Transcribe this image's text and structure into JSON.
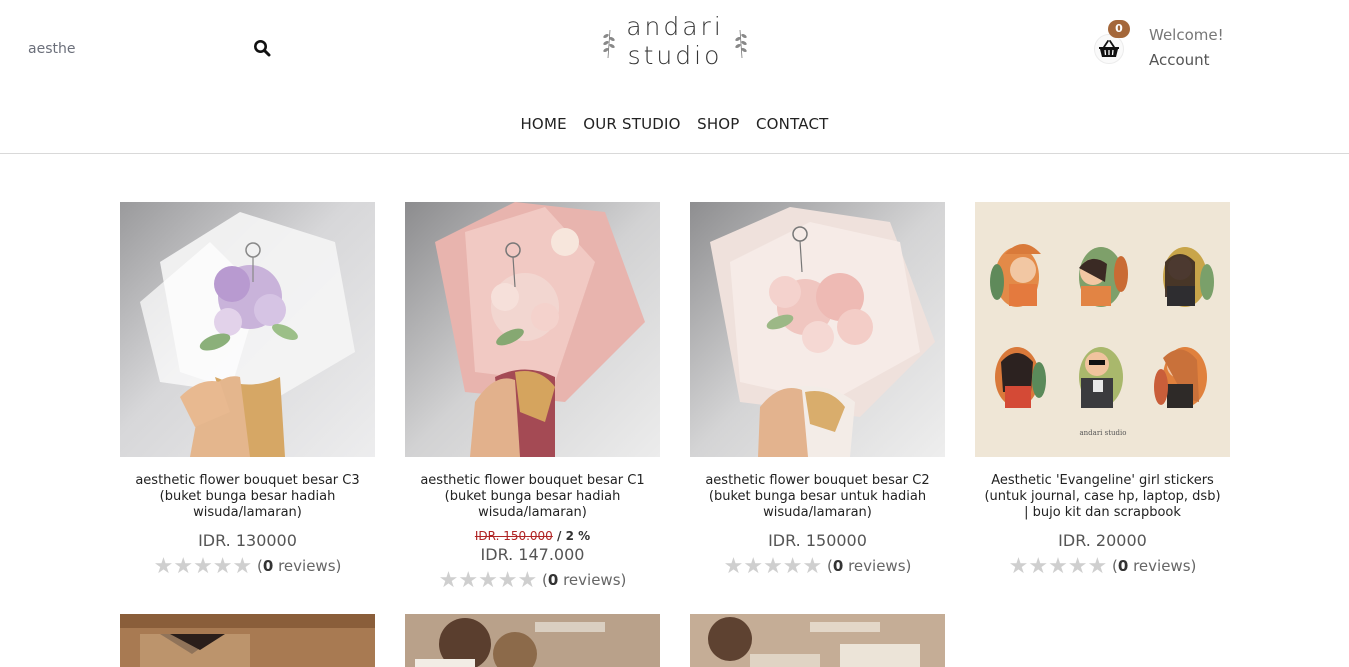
{
  "search": {
    "value": "aesthe",
    "placeholder": ""
  },
  "logo": {
    "line1": "andari",
    "line2": "studio"
  },
  "cart": {
    "count": "0"
  },
  "account": {
    "welcome": "Welcome!",
    "label": "Account"
  },
  "nav": [
    "HOME",
    "OUR STUDIO",
    "SHOP",
    "CONTACT"
  ],
  "products": [
    {
      "title": "aesthetic flower bouquet besar C3 (buket bunga besar hadiah wisuda/lamaran)",
      "price": "IDR. 130000",
      "old_price": "",
      "discount": "",
      "stars": "★★★★★",
      "reviews_prefix": "(",
      "reviews_count": "0",
      "reviews_suffix": " reviews)"
    },
    {
      "title": "aesthetic flower bouquet besar C1 (buket bunga besar hadiah wisuda/lamaran)",
      "price": "IDR. 147.000",
      "old_price": "IDR. 150.000",
      "discount": " / 2 %",
      "stars": "★★★★★",
      "reviews_prefix": "(",
      "reviews_count": "0",
      "reviews_suffix": " reviews)"
    },
    {
      "title": "aesthetic flower bouquet besar C2 (buket bunga besar untuk hadiah wisuda/lamaran)",
      "price": "IDR. 150000",
      "old_price": "",
      "discount": "",
      "stars": "★★★★★",
      "reviews_prefix": "(",
      "reviews_count": "0",
      "reviews_suffix": " reviews)"
    },
    {
      "title": "Aesthetic 'Evangeline' girl stickers (untuk journal, case hp, laptop, dsb) | bujo kit dan scrapbook",
      "price": "IDR. 20000",
      "old_price": "",
      "discount": "",
      "stars": "★★★★★",
      "reviews_prefix": "(",
      "reviews_count": "0",
      "reviews_suffix": " reviews)"
    }
  ],
  "colors": {
    "accent": "#a4673a",
    "strike": "#b02525",
    "divider": "#d9d9d9"
  }
}
